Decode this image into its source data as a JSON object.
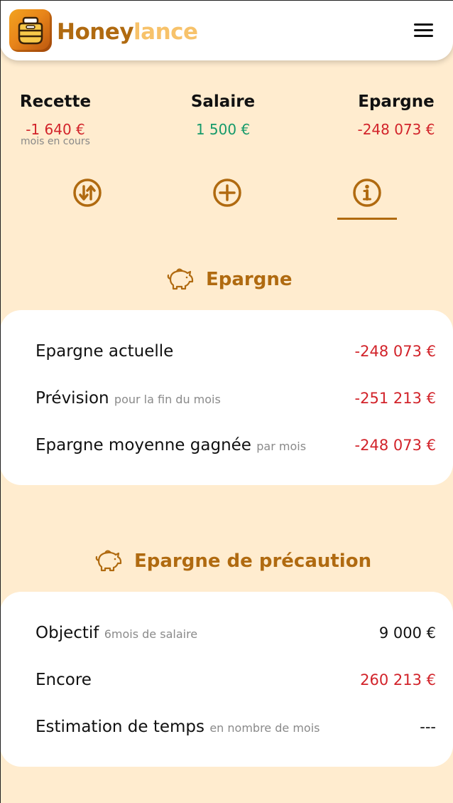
{
  "header": {
    "brand_part1": "Honey",
    "brand_part2": "lance",
    "logo_icon": "honey-pot-icon",
    "menu_icon": "hamburger-menu-icon"
  },
  "summary": {
    "recette": {
      "label": "Recette",
      "value": "-1 640 €",
      "sub": "mois en cours"
    },
    "salaire": {
      "label": "Salaire",
      "value": "1 500 €"
    },
    "epargne": {
      "label": "Epargne",
      "value": "-248 073 €"
    }
  },
  "actions": [
    {
      "icon": "transfer-arrows-icon"
    },
    {
      "icon": "add-circle-icon"
    },
    {
      "icon": "info-circle-icon",
      "active": true
    }
  ],
  "epargne_section": {
    "title": "Epargne",
    "icon": "piggy-bank-icon",
    "rows": [
      {
        "label": "Epargne actuelle",
        "hint": "",
        "value": "-248 073 €"
      },
      {
        "label": "Prévision",
        "hint": "pour la fin du mois",
        "value": "-251 213 €"
      },
      {
        "label": "Epargne moyenne gagnée",
        "hint": "par mois",
        "value": "-248 073 €"
      }
    ]
  },
  "precaution_section": {
    "title": "Epargne de précaution",
    "icon": "piggy-bank-icon",
    "rows": [
      {
        "label": "Objectif",
        "hint": "6mois de salaire",
        "value": "9 000 €"
      },
      {
        "label": "Encore",
        "hint": "",
        "value": "260 213 €"
      },
      {
        "label": "Estimation de temps",
        "hint": "en nombre de mois",
        "value": "---"
      }
    ]
  },
  "colors": {
    "background": "#ffeccf",
    "accent": "#b06a10",
    "negative": "#d2232a",
    "positive": "#159a6a"
  }
}
